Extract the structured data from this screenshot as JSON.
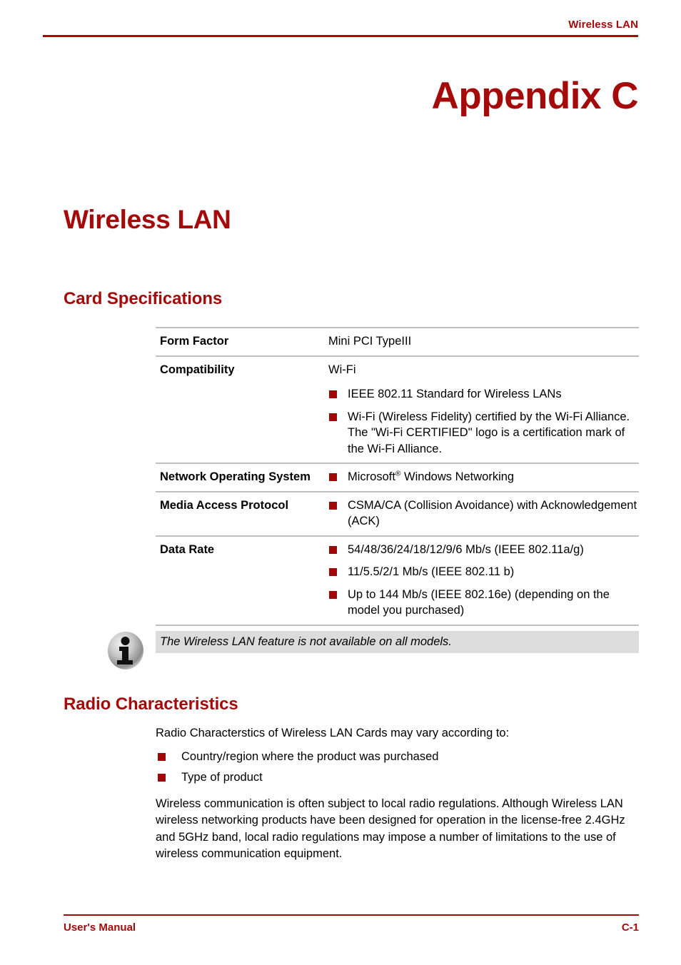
{
  "header": {
    "title": "Wireless LAN"
  },
  "appendix": {
    "title": "Appendix C"
  },
  "headings": {
    "h1": "Wireless LAN",
    "card_specifications": "Card Specifications",
    "radio_characteristics": "Radio Characteristics"
  },
  "spec_table": {
    "rows": [
      {
        "label": "Form Factor",
        "plain_value": "Mini PCI TypeIII",
        "bullets": []
      },
      {
        "label": "Compatibility",
        "plain_value": "Wi-Fi",
        "bullets": [
          "IEEE 802.11 Standard for Wireless LANs",
          "Wi-Fi (Wireless Fidelity) certified by the Wi-Fi Alliance. The \"Wi-Fi CERTIFIED\" logo is a certification mark of the Wi-Fi Alliance."
        ]
      },
      {
        "label": "Network Operating System",
        "plain_value": "",
        "bullets": [
          "Microsoft® Windows Networking"
        ]
      },
      {
        "label": "Media Access Protocol",
        "plain_value": "",
        "bullets": [
          "CSMA/CA (Collision Avoidance) with Acknowledgement (ACK)"
        ]
      },
      {
        "label": "Data Rate",
        "plain_value": "",
        "bullets": [
          "54/48/36/24/18/12/9/6 Mb/s (IEEE 802.11a/g)",
          "11/5.5/2/1 Mb/s (IEEE 802.11 b)",
          "Up to 144 Mb/s (IEEE 802.16e) (depending on the model you purchased)"
        ]
      }
    ]
  },
  "callout": {
    "icon": "info-icon",
    "text": "The Wireless LAN feature is not available on all models."
  },
  "radio": {
    "intro": "Radio Characterstics of Wireless LAN Cards may vary according to:",
    "bullets": [
      "Country/region where the product was purchased",
      "Type of product"
    ],
    "paragraph": "Wireless communication is often subject to local radio regulations. Although Wireless LAN wireless networking products have been designed for operation in the license-free 2.4GHz and 5GHz band, local radio regulations may impose a number of limitations to the use of wireless communication equipment."
  },
  "footer": {
    "left": "User's Manual",
    "right": "C-1"
  },
  "colors": {
    "brand_red": "#A50A0A",
    "bullet_red": "#A00808",
    "rule_gray": "#BFBFBF",
    "callout_gray": "#DCDCDC"
  }
}
